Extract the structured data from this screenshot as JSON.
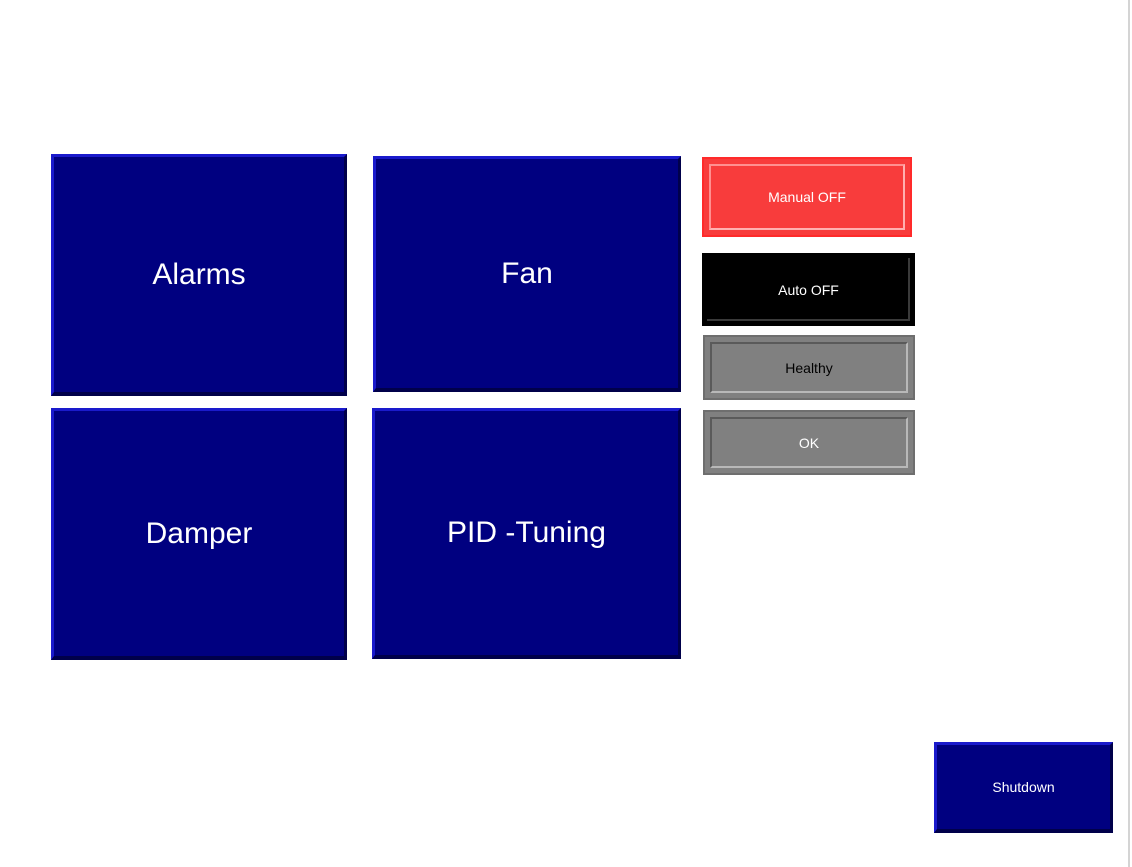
{
  "nav_buttons": {
    "alarms": "Alarms",
    "fan": "Fan",
    "damper": "Damper",
    "pid_tuning": "PID -Tuning"
  },
  "status": {
    "manual": "Manual OFF",
    "auto": "Auto OFF",
    "health": "Healthy",
    "ok": "OK"
  },
  "shutdown_label": "Shutdown",
  "colors": {
    "nav_button": "#000080",
    "manual_off": "#f83c3c",
    "auto_off": "#000000",
    "status_gray": "#808080"
  }
}
